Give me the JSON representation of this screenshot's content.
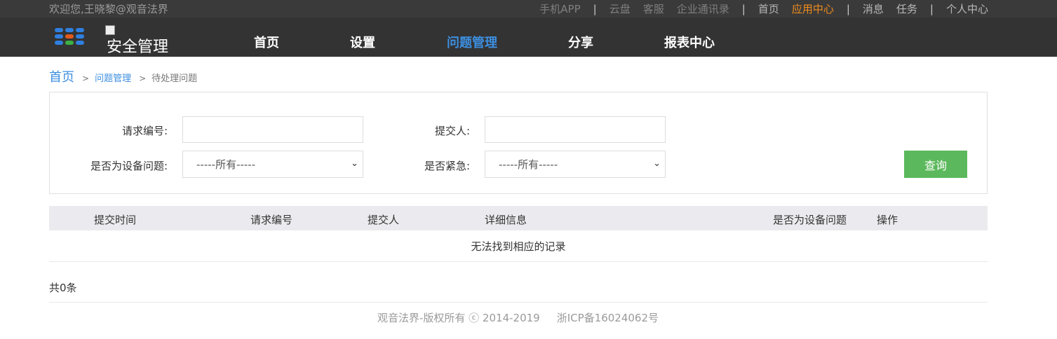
{
  "topbar": {
    "welcome": "欢迎您,王晓黎@观音法界",
    "links": [
      {
        "label": "手机APP",
        "style": "dim"
      },
      {
        "sep": "|"
      },
      {
        "label": "云盘",
        "style": "dim"
      },
      {
        "label": "客服",
        "style": "dim"
      },
      {
        "label": "企业通讯录",
        "style": "dim"
      },
      {
        "sep": "|"
      },
      {
        "label": "首页",
        "style": "light"
      },
      {
        "label": "应用中心",
        "style": "active"
      },
      {
        "sep": "|"
      },
      {
        "label": "消息",
        "style": "light"
      },
      {
        "label": "任务",
        "style": "light"
      },
      {
        "sep": "|"
      },
      {
        "label": "个人中心",
        "style": "light"
      }
    ]
  },
  "navbar": {
    "logo_text": "安全管理",
    "items": [
      {
        "label": "首页"
      },
      {
        "label": "设置"
      },
      {
        "label": "问题管理",
        "active": true
      },
      {
        "label": "分享"
      },
      {
        "label": "报表中心"
      }
    ],
    "grid_colors": [
      "#2f7fe0",
      "#2f7fe0",
      "#2f7fe0",
      "#2f7fe0",
      "#e05a1e",
      "#2f7fe0",
      "#2f7fe0",
      "#3cb044",
      "#2f7fe0"
    ]
  },
  "breadcrumb": {
    "home": "首页",
    "sep": ">",
    "section": "问题管理",
    "current": "待处理问题"
  },
  "search": {
    "request_no_label": "请求编号:",
    "request_no_value": "",
    "submitter_label": "提交人:",
    "submitter_value": "",
    "device_issue_label": "是否为设备问题:",
    "device_issue_value": "-----所有-----",
    "urgent_label": "是否紧急:",
    "urgent_value": "-----所有-----",
    "query_button": "查询"
  },
  "table": {
    "columns": [
      "提交时间",
      "请求编号",
      "提交人",
      "详细信息",
      "是否为设备问题",
      "操作"
    ],
    "rows": [],
    "empty_text": "无法找到相应的记录"
  },
  "summary": {
    "total": "共0条"
  },
  "footer": {
    "copyright": "观音法界-版权所有 ⓒ 2014-2019",
    "icp": "浙ICP备16024062号"
  }
}
